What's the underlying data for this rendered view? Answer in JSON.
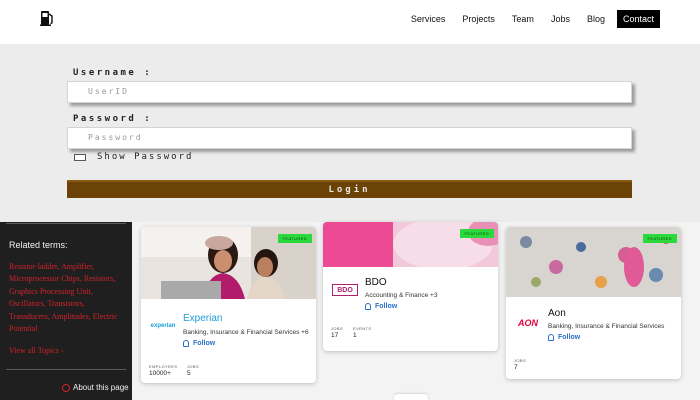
{
  "nav": {
    "logo_icon": "fuel-pump-icon",
    "links": [
      "Services",
      "Projects",
      "Team",
      "Jobs",
      "Blog"
    ],
    "contact": "Contact"
  },
  "login": {
    "username_label": "Username :",
    "username_placeholder": "UserID",
    "password_label": "Password :",
    "password_placeholder": "Password",
    "show_password": "Show Password",
    "submit": "Login"
  },
  "sidebar": {
    "title": "Related terms:",
    "terms": "Resistor-ladder, Amplifier, Microprocessor Chips, Resistors, Graphics Processing Unit, Oscillators, Transistors, Transducers, Amplitudes, Electric Potential",
    "view_all": "View all Topics  ›",
    "about": "About this page",
    "accent_color": "#d2232a"
  },
  "cards": [
    {
      "badge": "FEATURED",
      "logo": "experian",
      "name": "Experian",
      "category": "Banking, Insurance & Financial Services +6",
      "follow": "Follow",
      "stats": [
        {
          "label": "EMPLOYEES",
          "value": "10000+"
        },
        {
          "label": "JOBS",
          "value": "5"
        }
      ]
    },
    {
      "badge": "FEATURED",
      "logo": "BDO",
      "name": "BDO",
      "category": "Accounting & Finance +3",
      "follow": "Follow",
      "stats": [
        {
          "label": "JOBS",
          "value": "17"
        },
        {
          "label": "EVENTS",
          "value": "1"
        }
      ]
    },
    {
      "badge": "FEATURED",
      "logo": "AON",
      "name": "Aon",
      "category": "Banking, Insurance & Financial Services",
      "follow": "Follow",
      "stats": [
        {
          "label": "JOBS",
          "value": "7"
        }
      ]
    }
  ],
  "colors": {
    "login_button": "#6b4306",
    "badge": "#2bd93c",
    "follow": "#2a6fc9",
    "experian_name": "#1a9ed8",
    "aon_logo": "#e4003b"
  }
}
